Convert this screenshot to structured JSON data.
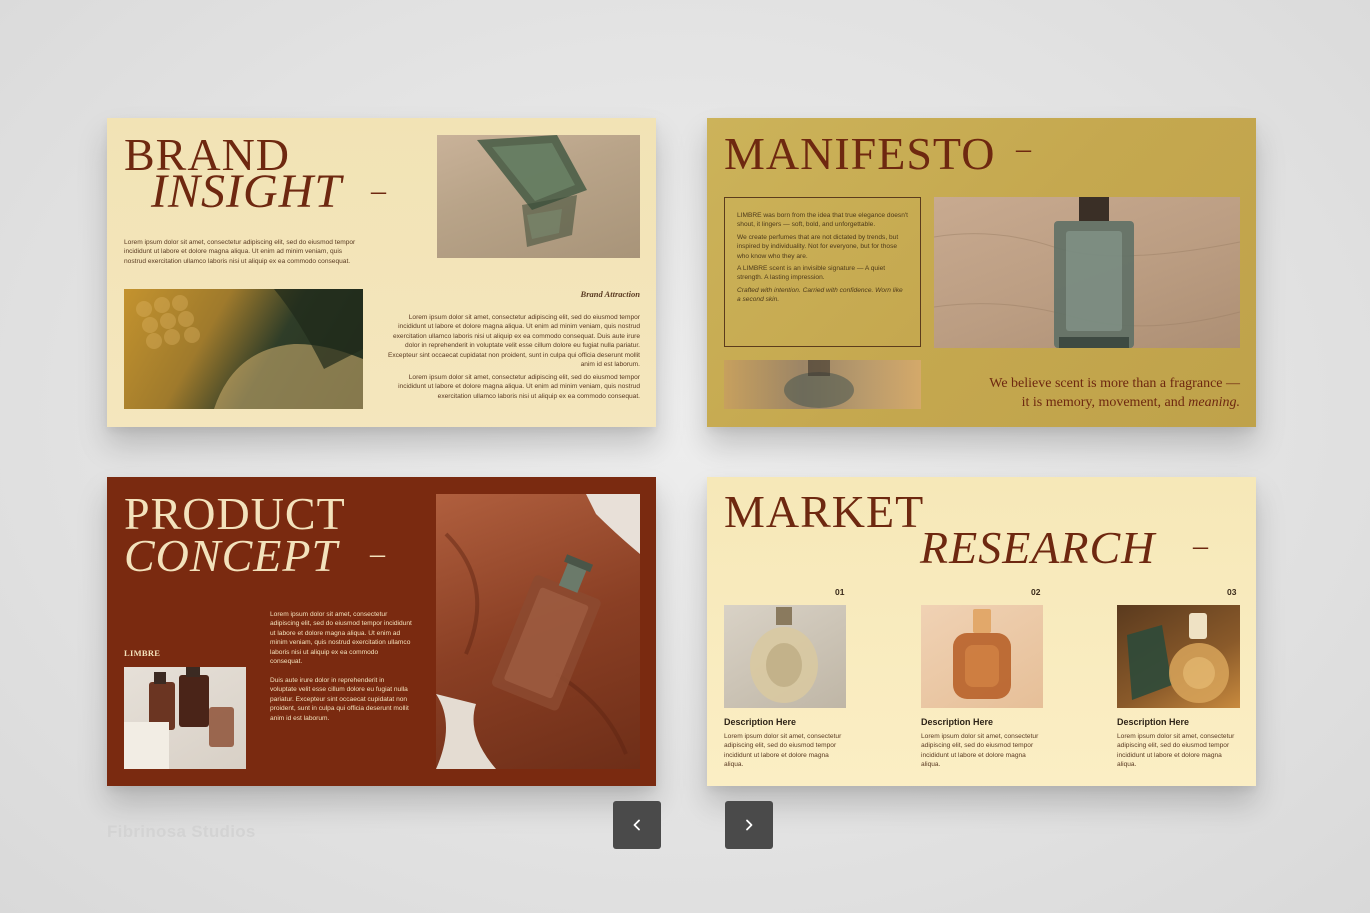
{
  "slides": {
    "brand_insight": {
      "title_line1": "BRAND",
      "title_line2": "INSIGHT",
      "dash": "–",
      "intro": "Lorem ipsum dolor sit amet, consectetur adipiscing elit, sed do eiusmod tempor incididunt ut labore et dolore magna aliqua. Ut enim ad minim veniam, quis nostrud exercitation ullamco laboris nisi ut aliquip ex ea commodo consequat.",
      "subheading": "Brand Attraction",
      "para1": "Lorem ipsum dolor sit amet, consectetur adipiscing elit, sed do eiusmod tempor incididunt ut labore et dolore magna aliqua. Ut enim ad minim veniam, quis nostrud exercitation ullamco laboris nisi ut aliquip ex ea commodo consequat. Duis aute irure dolor in reprehenderit in voluptate velit esse cillum dolore eu fugiat nulla pariatur. Excepteur sint occaecat cupidatat non proident, sunt in culpa qui officia deserunt mollit anim id est laborum.",
      "para2": "Lorem ipsum dolor sit amet, consectetur adipiscing elit, sed do eiusmod tempor incididunt ut labore et dolore magna aliqua. Ut enim ad minim veniam, quis nostrud exercitation ullamco laboris nisi ut aliquip ex ea commodo consequat."
    },
    "manifesto": {
      "title": "MANIFESTO",
      "dash": "–",
      "box_p1": "LIMBRE was born from the idea that true elegance doesn't shout, it lingers — soft, bold, and unforgettable.",
      "box_p2": "We create perfumes that are not dictated by trends, but inspired by individuality. Not for everyone, but for those who know who they are.",
      "box_p3": "A LIMBRE scent is an invisible signature — A quiet strength. A lasting impression.",
      "box_p4": "Crafted with intention. Carried with confidence. Worn like a second skin.",
      "quote_line1": "We believe scent is more than a fragrance —",
      "quote_line2_a": "it is memory, movement, and ",
      "quote_line2_b": "meaning."
    },
    "product_concept": {
      "title_line1": "PRODUCT",
      "title_line2": "CONCEPT",
      "dash": "–",
      "brand": "LIMBRE",
      "para1": "Lorem ipsum dolor sit amet, consectetur adipiscing elit, sed do eiusmod tempor incididunt ut labore et dolore magna aliqua. Ut enim ad minim veniam, quis nostrud exercitation ullamco laboris nisi ut aliquip ex ea commodo consequat.",
      "para2": "Duis aute irure dolor in reprehenderit in voluptate velit esse cillum dolore eu fugiat nulla pariatur. Excepteur sint occaecat cupidatat non proident, sunt in culpa qui officia deserunt mollit anim id est laborum."
    },
    "market_research": {
      "title_line1": "MARKET",
      "title_line2": "RESEARCH",
      "dash": "–",
      "items": [
        {
          "num": "01",
          "heading": "Description Here",
          "text": "Lorem ipsum dolor sit amet, consectetur adipiscing elit, sed do eiusmod tempor incididunt ut labore et dolore magna aliqua."
        },
        {
          "num": "02",
          "heading": "Description Here",
          "text": "Lorem ipsum dolor sit amet, consectetur adipiscing elit, sed do eiusmod tempor incididunt ut labore et dolore magna aliqua."
        },
        {
          "num": "03",
          "heading": "Description Here",
          "text": "Lorem ipsum dolor sit amet, consectetur adipiscing elit, sed do eiusmod tempor incididunt ut labore et dolore magna aliqua."
        }
      ]
    }
  },
  "watermark": "Fibrinosa Studios",
  "nav": {
    "prev_icon": "chevron-left-icon",
    "next_icon": "chevron-right-icon"
  },
  "colors": {
    "deep_red": "#7a2a10",
    "title_brown": "#6e2810",
    "cream": "#f4e6bd",
    "mustard": "#c5a84f",
    "button": "#4a4a4a"
  }
}
